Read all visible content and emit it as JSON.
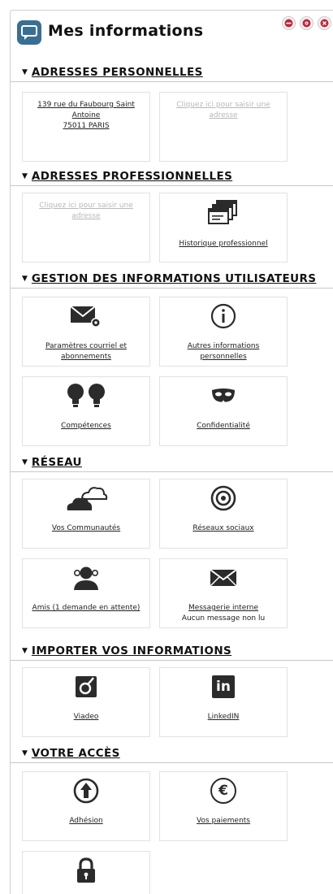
{
  "header": {
    "title": "Mes informations",
    "app_icon": "chat-bubble-icon",
    "controls": [
      "minimize-icon",
      "settings-icon",
      "close-icon"
    ]
  },
  "colors": {
    "app_icon_bg": "#3a6f93",
    "window_control_red": "#c0273a",
    "icon_dark": "#2b2b2b"
  },
  "sections": [
    {
      "title": "ADRESSES PERSONNELLES",
      "tiles": [
        {
          "lines": [
            "139 rue du Faubourg Saint Antoine",
            "75011 PARIS"
          ]
        },
        {
          "text": "Cliquez ici pour saisir une adresse"
        }
      ]
    },
    {
      "title": "ADRESSES PROFESSIONNELLES",
      "tiles": [
        {
          "text": "Cliquez ici pour saisir une adresse"
        },
        {
          "label": "Historique professionnel",
          "icon": "windows-stack-icon"
        }
      ]
    },
    {
      "title": "GESTION DES INFORMATIONS UTILISATEURS",
      "tiles": [
        {
          "label": "Paramètres courriel et abonnements",
          "icon": "mail-settings-icon"
        },
        {
          "label": "Autres informations personnelles",
          "icon": "info-icon"
        },
        {
          "label": "Compétences",
          "icon": "lightbulbs-icon"
        },
        {
          "label": "Confidentialité",
          "icon": "mask-icon"
        }
      ]
    },
    {
      "title": "RÉSEAU",
      "tiles": [
        {
          "label": "Vos Communautés",
          "icon": "clouds-icon"
        },
        {
          "label": "Réseaux sociaux",
          "icon": "target-icon"
        },
        {
          "label": "Amis (1 demande en attente)",
          "icon": "friends-icon"
        },
        {
          "label": "Messagerie interne",
          "sub": "Aucun message non lu",
          "icon": "envelope-icon"
        }
      ]
    },
    {
      "title": "IMPORTER VOS INFORMATIONS",
      "tiles": [
        {
          "label": "Viadeo",
          "icon": "viadeo-icon"
        },
        {
          "label": "LinkedIN",
          "icon": "linkedin-icon",
          "icon_text": "in"
        }
      ]
    },
    {
      "title": "VOTRE ACCÈS",
      "tiles": [
        {
          "label": "Adhésion",
          "icon": "arrow-up-circle-icon"
        },
        {
          "label": "Vos paiements",
          "icon": "euro-icon",
          "icon_text": "€"
        },
        {
          "label": "",
          "icon": "lock-icon"
        }
      ]
    }
  ]
}
